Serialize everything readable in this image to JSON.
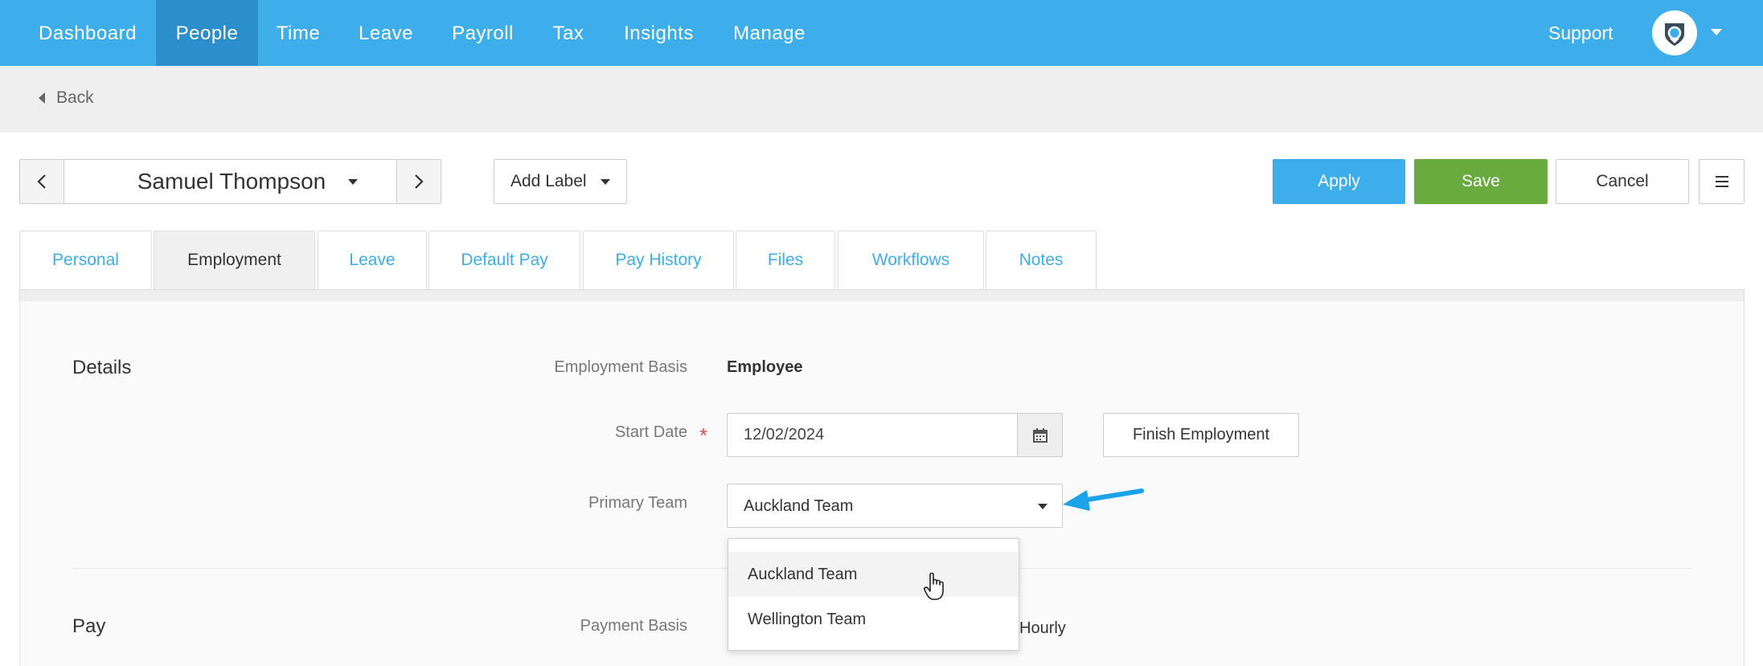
{
  "nav": {
    "items": [
      {
        "label": "Dashboard"
      },
      {
        "label": "People",
        "active": true
      },
      {
        "label": "Time"
      },
      {
        "label": "Leave"
      },
      {
        "label": "Payroll"
      },
      {
        "label": "Tax"
      },
      {
        "label": "Insights"
      },
      {
        "label": "Manage"
      }
    ],
    "support_label": "Support",
    "accent_color": "#3daeea",
    "active_color": "#2a8fcc"
  },
  "back": {
    "label": "Back"
  },
  "toolbar": {
    "employee_name": "Samuel Thompson",
    "add_label": "Add Label",
    "apply_label": "Apply",
    "save_label": "Save",
    "cancel_label": "Cancel",
    "save_color": "#6aab3f"
  },
  "tabs": [
    {
      "label": "Personal"
    },
    {
      "label": "Employment",
      "active": true
    },
    {
      "label": "Leave"
    },
    {
      "label": "Default Pay"
    },
    {
      "label": "Pay History"
    },
    {
      "label": "Files"
    },
    {
      "label": "Workflows"
    },
    {
      "label": "Notes"
    }
  ],
  "details": {
    "title": "Details",
    "employment_basis_label": "Employment Basis",
    "employment_basis_value": "Employee",
    "start_date_label": "Start Date",
    "required_marker": "*",
    "start_date_value": "12/02/2024",
    "finish_employment_label": "Finish Employment",
    "primary_team_label": "Primary Team",
    "primary_team_value": "Auckland Team",
    "team_options": [
      "Auckland Team",
      "Wellington Team"
    ]
  },
  "pay": {
    "title": "Pay",
    "payment_basis_label": "Payment Basis",
    "payment_basis_value": "Hourly"
  },
  "icons": {
    "back": "caret-left-icon",
    "prev": "chevron-left-icon",
    "next": "chevron-right-icon",
    "calendar": "calendar-icon",
    "menu": "hamburger-menu-icon",
    "avatar": "user-shield-icon",
    "annotation": "blue-arrow-icon",
    "cursor": "hand-pointer-cursor-icon"
  }
}
